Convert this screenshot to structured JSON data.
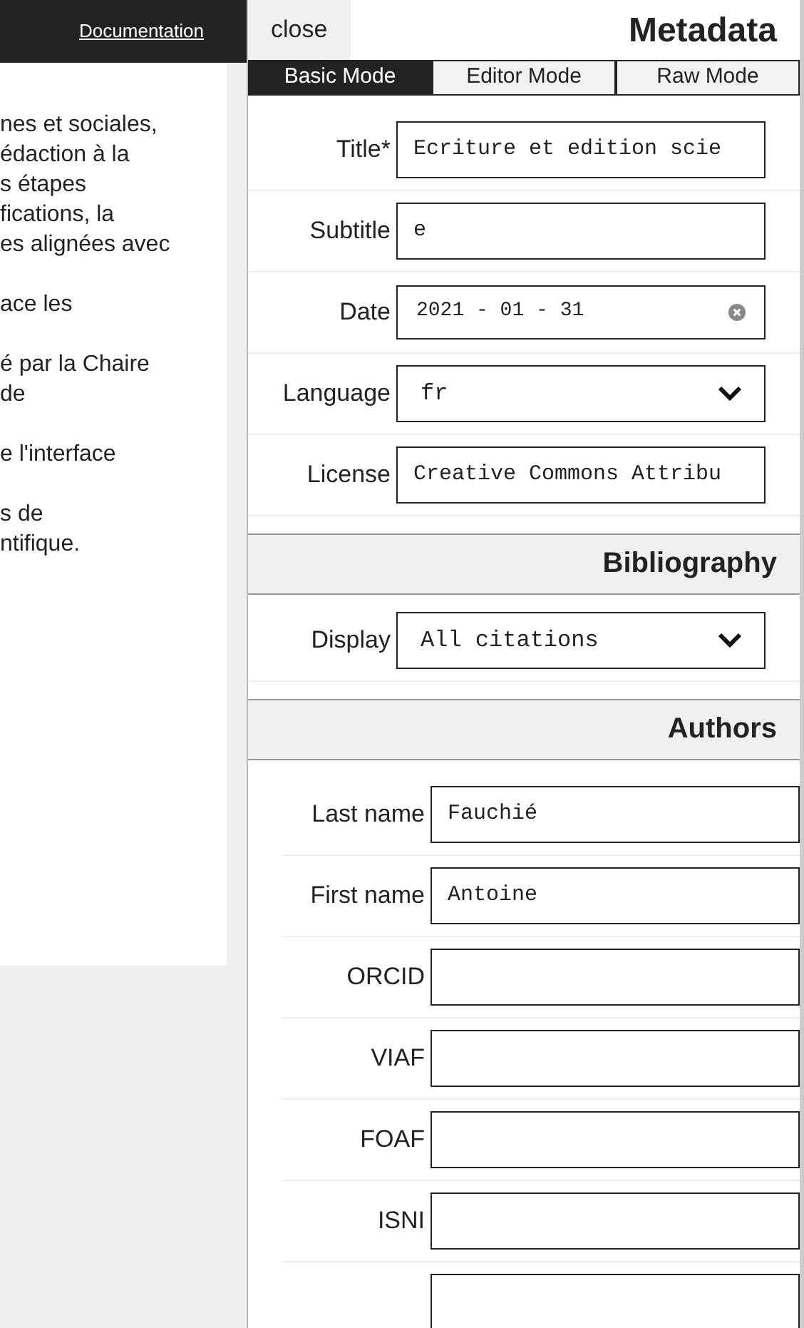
{
  "header": {
    "link": "Documentation"
  },
  "document": {
    "paragraphs": [
      [
        "nes et sociales,",
        "édaction à la",
        "s étapes",
        "fications, la",
        "es alignées avec"
      ],
      [
        "ace les"
      ],
      [
        "é par la Chaire",
        "de"
      ],
      [
        "e l'interface"
      ],
      [
        "s de",
        "ntifique."
      ]
    ]
  },
  "panel": {
    "close": "close",
    "title": "Metadata",
    "tabs": [
      {
        "label": "Basic Mode",
        "selected": true
      },
      {
        "label": "Editor Mode",
        "selected": false
      },
      {
        "label": "Raw Mode",
        "selected": false
      }
    ],
    "fields": [
      {
        "label": "Title*",
        "kind": "text",
        "value": "Ecriture et edition scie"
      },
      {
        "label": "Subtitle",
        "kind": "text",
        "value": "e"
      },
      {
        "label": "Date",
        "kind": "date",
        "value": "2021 - 01 - 31"
      },
      {
        "label": "Language",
        "kind": "select",
        "value": "fr"
      },
      {
        "label": "License",
        "kind": "text",
        "value": "Creative Commons Attribu"
      }
    ],
    "sections": [
      {
        "title": "Bibliography",
        "fields": [
          {
            "label": "Display",
            "kind": "select",
            "value": "All citations"
          }
        ]
      },
      {
        "title": "Authors",
        "fields": [
          {
            "label": "Last name",
            "kind": "text",
            "value": "Fauchié"
          },
          {
            "label": "First name",
            "kind": "text",
            "value": "Antoine"
          },
          {
            "label": "ORCID",
            "kind": "text"
          },
          {
            "label": "VIAF",
            "kind": "text"
          },
          {
            "label": "FOAF",
            "kind": "text"
          },
          {
            "label": "ISNI",
            "kind": "text"
          },
          {
            "kind": "text"
          }
        ]
      }
    ]
  }
}
